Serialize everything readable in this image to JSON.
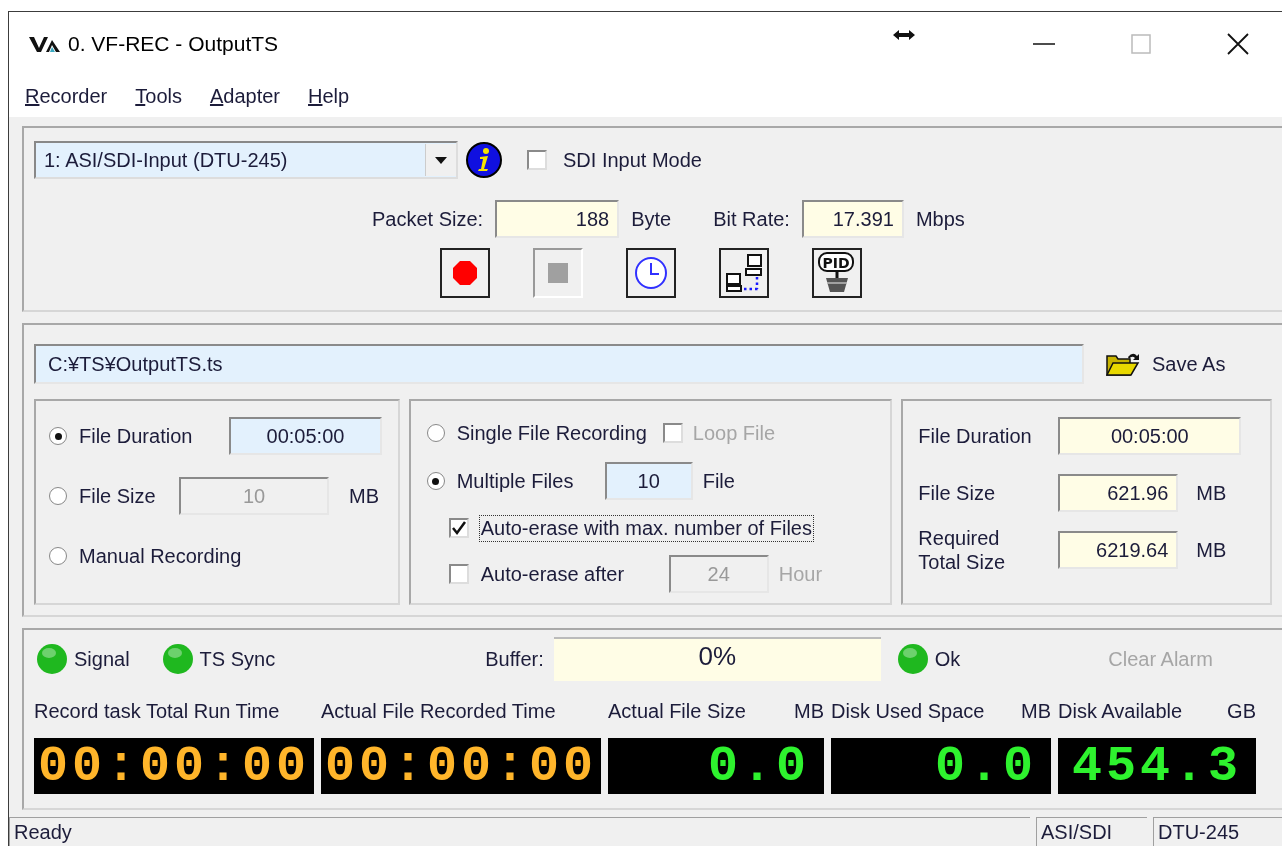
{
  "window": {
    "title": "0. VF-REC - OutputTS"
  },
  "menu": [
    {
      "label": "Recorder"
    },
    {
      "label": "Tools"
    },
    {
      "label": "Adapter"
    },
    {
      "label": "Help"
    }
  ],
  "device": {
    "value": "1: ASI/SDI-Input (DTU-245)",
    "sdi_input_mode": {
      "label": "SDI Input Mode",
      "checked": false
    }
  },
  "packet_size": {
    "label": "Packet Size:",
    "value": "188",
    "unit": "Byte"
  },
  "bit_rate": {
    "label": "Bit Rate:",
    "value": "17.391",
    "unit": "Mbps"
  },
  "toolbar": [
    {
      "kind": "record",
      "disabled": false
    },
    {
      "kind": "stop",
      "disabled": true
    },
    {
      "kind": "schedule",
      "disabled": false
    },
    {
      "kind": "network",
      "disabled": false
    },
    {
      "kind": "pid",
      "disabled": false,
      "label": "PID"
    }
  ],
  "output": {
    "path": "C:¥TS¥OutputTS.ts",
    "save_as": "Save As"
  },
  "split_mode": [
    {
      "label": "File Duration",
      "selected": true,
      "value": "00:05:00",
      "disabled": false
    },
    {
      "label": "File Size",
      "selected": false,
      "value": "10",
      "unit": "MB",
      "disabled": true
    },
    {
      "label": "Manual Recording",
      "selected": false
    }
  ],
  "file_mode": {
    "single": {
      "label": "Single File Recording",
      "selected": false
    },
    "loop_file": {
      "label": "Loop File",
      "checked": false,
      "disabled": true
    },
    "multiple": {
      "label": "Multiple Files",
      "selected": true,
      "value": "10",
      "unit": "File"
    },
    "auto_erase_max": {
      "label": "Auto-erase with max. number of Files",
      "checked": true,
      "focused": true
    },
    "auto_erase_after": {
      "label": "Auto-erase after",
      "checked": false,
      "value": "24",
      "unit": "Hour",
      "disabled": true
    }
  },
  "summary": [
    {
      "label": "File Duration",
      "value": "00:05:00"
    },
    {
      "label": "File Size",
      "value": "621.96",
      "unit": "MB"
    },
    {
      "label": "Required Total Size",
      "value": "6219.64",
      "unit": "MB"
    }
  ],
  "indicators": [
    {
      "label": "Signal",
      "color": "#1fb81f"
    },
    {
      "label": "TS Sync",
      "color": "#1fb81f"
    }
  ],
  "buffer": {
    "label": "Buffer:",
    "level": 0,
    "reading": "0%"
  },
  "alarm": {
    "label": "Ok",
    "color": "#1fb81f"
  },
  "clear_alarm": {
    "label": "Clear Alarm",
    "disabled": true
  },
  "meters": [
    {
      "label": "Record task Total Run Time",
      "value": "00:00:00",
      "kind": "time"
    },
    {
      "label": "Actual File Recorded Time",
      "value": "00:00:00",
      "kind": "time"
    },
    {
      "label": "Actual File Size",
      "unit": "MB",
      "value": "0.0",
      "kind": "size"
    },
    {
      "label": "Disk Used Space",
      "unit": "MB",
      "value": "0.0",
      "kind": "size"
    },
    {
      "label": "Disk Available",
      "unit": "GB",
      "value": "454.3",
      "kind": "size"
    }
  ],
  "status_bar": [
    "Ready",
    "ASI/SDI",
    "DTU-245"
  ]
}
